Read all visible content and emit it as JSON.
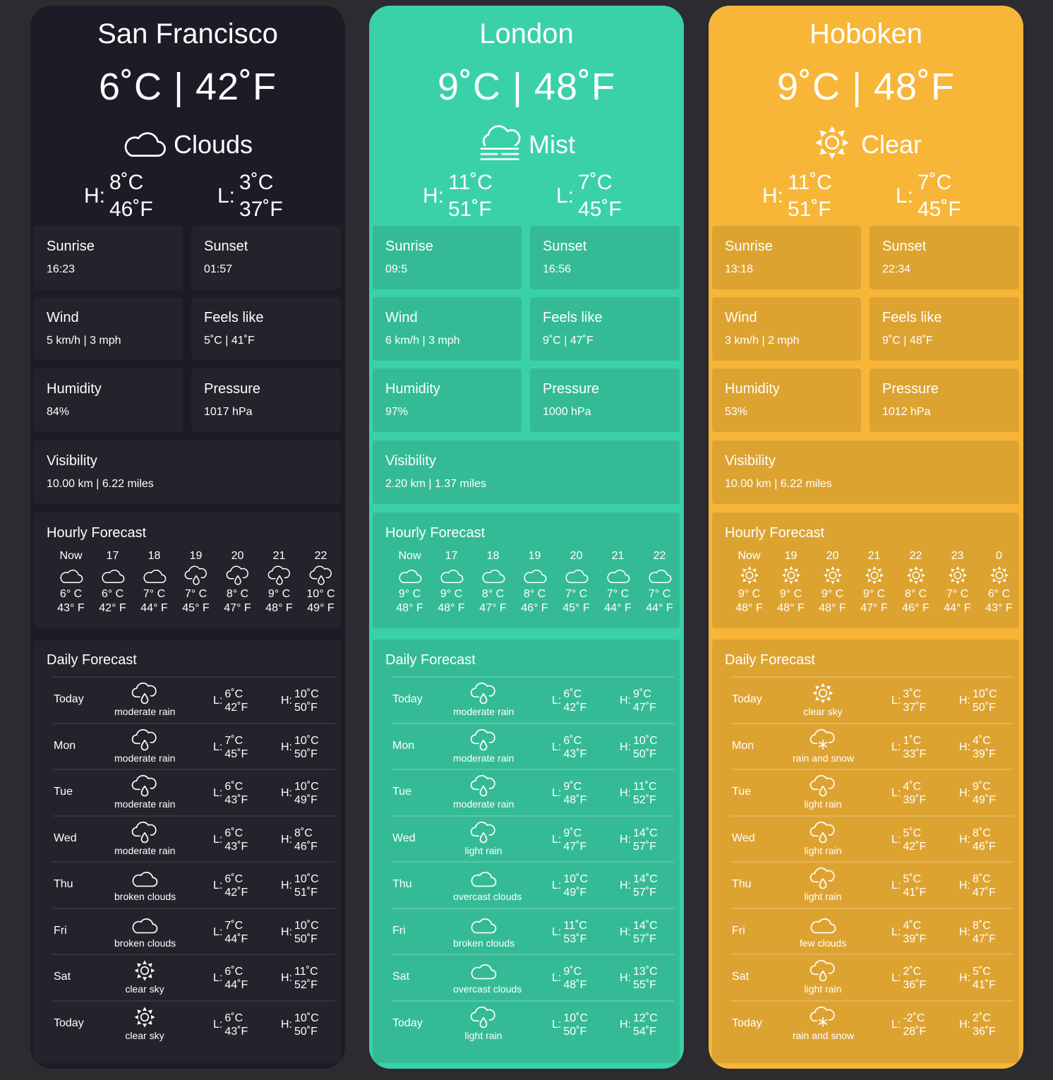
{
  "cities": [
    {
      "name": "San Francisco",
      "temp": "6˚C | 42˚F",
      "condition": "Clouds",
      "condition_icon": "cloud-icon",
      "high_c": "8˚C",
      "high_f": "46˚F",
      "low_c": "3˚C",
      "low_f": "37˚F",
      "hl_labels": {
        "high": "H:",
        "low": "L:"
      },
      "accent": "#1c1c26",
      "sunrise": {
        "label": "Sunrise",
        "value": "16:23"
      },
      "sunset": {
        "label": "Sunset",
        "value": "01:57"
      },
      "wind": {
        "label": "Wind",
        "value": "5 km/h | 3 mph"
      },
      "feels": {
        "label": "Feels like",
        "value": "5˚C | 41˚F"
      },
      "humidity": {
        "label": "Humidity",
        "value": "84%"
      },
      "pressure": {
        "label": "Pressure",
        "value": "1017 hPa"
      },
      "visibility": {
        "label": "Visibility",
        "value": "10.00 km | 6.22 miles"
      },
      "hourly_title": "Hourly Forecast",
      "hourly": [
        {
          "time": "Now",
          "icon": "cloud",
          "c": "6° C",
          "f": "43° F"
        },
        {
          "time": "17",
          "icon": "cloud",
          "c": "6° C",
          "f": "42° F"
        },
        {
          "time": "18",
          "icon": "cloud",
          "c": "7° C",
          "f": "44° F"
        },
        {
          "time": "19",
          "icon": "rain",
          "c": "7° C",
          "f": "45° F"
        },
        {
          "time": "20",
          "icon": "rain",
          "c": "8° C",
          "f": "47° F"
        },
        {
          "time": "21",
          "icon": "rain",
          "c": "9° C",
          "f": "48° F"
        },
        {
          "time": "22",
          "icon": "rain",
          "c": "10° C",
          "f": "49° F"
        }
      ],
      "daily_title": "Daily Forecast",
      "daily": [
        {
          "day": "Today",
          "icon": "rain",
          "desc": "moderate rain",
          "lo_c": "6˚C",
          "lo_f": "42˚F",
          "hi_c": "10˚C",
          "hi_f": "50˚F"
        },
        {
          "day": "Mon",
          "icon": "rain",
          "desc": "moderate rain",
          "lo_c": "7˚C",
          "lo_f": "45˚F",
          "hi_c": "10˚C",
          "hi_f": "50˚F"
        },
        {
          "day": "Tue",
          "icon": "rain",
          "desc": "moderate rain",
          "lo_c": "6˚C",
          "lo_f": "43˚F",
          "hi_c": "10˚C",
          "hi_f": "49˚F"
        },
        {
          "day": "Wed",
          "icon": "rain",
          "desc": "moderate rain",
          "lo_c": "6˚C",
          "lo_f": "43˚F",
          "hi_c": "8˚C",
          "hi_f": "46˚F"
        },
        {
          "day": "Thu",
          "icon": "cloud",
          "desc": "broken clouds",
          "lo_c": "6˚C",
          "lo_f": "42˚F",
          "hi_c": "10˚C",
          "hi_f": "51˚F"
        },
        {
          "day": "Fri",
          "icon": "cloud",
          "desc": "broken clouds",
          "lo_c": "7˚C",
          "lo_f": "44˚F",
          "hi_c": "10˚C",
          "hi_f": "50˚F"
        },
        {
          "day": "Sat",
          "icon": "sun",
          "desc": "clear sky",
          "lo_c": "6˚C",
          "lo_f": "44˚F",
          "hi_c": "11˚C",
          "hi_f": "52˚F"
        },
        {
          "day": "Today",
          "icon": "sun",
          "desc": "clear sky",
          "lo_c": "6˚C",
          "lo_f": "43˚F",
          "hi_c": "10˚C",
          "hi_f": "50˚F"
        }
      ]
    },
    {
      "name": "London",
      "temp": "9˚C | 48˚F",
      "condition": "Mist",
      "condition_icon": "mist-icon",
      "high_c": "11˚C",
      "high_f": "51˚F",
      "low_c": "7˚C",
      "low_f": "45˚F",
      "hl_labels": {
        "high": "H:",
        "low": "L:"
      },
      "accent": "#3ad1a8",
      "sunrise": {
        "label": "Sunrise",
        "value": "09:5"
      },
      "sunset": {
        "label": "Sunset",
        "value": "16:56"
      },
      "wind": {
        "label": "Wind",
        "value": "6 km/h | 3 mph"
      },
      "feels": {
        "label": "Feels like",
        "value": "9˚C | 47˚F"
      },
      "humidity": {
        "label": "Humidity",
        "value": "97%"
      },
      "pressure": {
        "label": "Pressure",
        "value": "1000 hPa"
      },
      "visibility": {
        "label": "Visibility",
        "value": "2.20 km | 1.37 miles"
      },
      "hourly_title": "Hourly Forecast",
      "hourly": [
        {
          "time": "Now",
          "icon": "cloud",
          "c": "9° C",
          "f": "48° F"
        },
        {
          "time": "17",
          "icon": "cloud",
          "c": "9° C",
          "f": "48° F"
        },
        {
          "time": "18",
          "icon": "cloud",
          "c": "8° C",
          "f": "47° F"
        },
        {
          "time": "19",
          "icon": "cloud",
          "c": "8° C",
          "f": "46° F"
        },
        {
          "time": "20",
          "icon": "cloud",
          "c": "7° C",
          "f": "45° F"
        },
        {
          "time": "21",
          "icon": "cloud",
          "c": "7° C",
          "f": "44° F"
        },
        {
          "time": "22",
          "icon": "cloud",
          "c": "7° C",
          "f": "44° F"
        }
      ],
      "daily_title": "Daily Forecast",
      "daily": [
        {
          "day": "Today",
          "icon": "rain",
          "desc": "moderate rain",
          "lo_c": "6˚C",
          "lo_f": "42˚F",
          "hi_c": "9˚C",
          "hi_f": "47˚F"
        },
        {
          "day": "Mon",
          "icon": "rain",
          "desc": "moderate rain",
          "lo_c": "6˚C",
          "lo_f": "43˚F",
          "hi_c": "10˚C",
          "hi_f": "50˚F"
        },
        {
          "day": "Tue",
          "icon": "rain",
          "desc": "moderate rain",
          "lo_c": "9˚C",
          "lo_f": "48˚F",
          "hi_c": "11˚C",
          "hi_f": "52˚F"
        },
        {
          "day": "Wed",
          "icon": "rain",
          "desc": "light rain",
          "lo_c": "9˚C",
          "lo_f": "47˚F",
          "hi_c": "14˚C",
          "hi_f": "57˚F"
        },
        {
          "day": "Thu",
          "icon": "cloud",
          "desc": "overcast clouds",
          "lo_c": "10˚C",
          "lo_f": "49˚F",
          "hi_c": "14˚C",
          "hi_f": "57˚F"
        },
        {
          "day": "Fri",
          "icon": "cloud",
          "desc": "broken clouds",
          "lo_c": "11˚C",
          "lo_f": "53˚F",
          "hi_c": "14˚C",
          "hi_f": "57˚F"
        },
        {
          "day": "Sat",
          "icon": "cloud",
          "desc": "overcast clouds",
          "lo_c": "9˚C",
          "lo_f": "48˚F",
          "hi_c": "13˚C",
          "hi_f": "55˚F"
        },
        {
          "day": "Today",
          "icon": "rain",
          "desc": "light rain",
          "lo_c": "10˚C",
          "lo_f": "50˚F",
          "hi_c": "12˚C",
          "hi_f": "54˚F"
        }
      ]
    },
    {
      "name": "Hoboken",
      "temp": "9˚C | 48˚F",
      "condition": "Clear",
      "condition_icon": "sun-icon",
      "high_c": "11˚C",
      "high_f": "51˚F",
      "low_c": "7˚C",
      "low_f": "45˚F",
      "hl_labels": {
        "high": "H:",
        "low": "L:"
      },
      "accent": "#f7b637",
      "sunrise": {
        "label": "Sunrise",
        "value": "13:18"
      },
      "sunset": {
        "label": "Sunset",
        "value": "22:34"
      },
      "wind": {
        "label": "Wind",
        "value": "3 km/h | 2 mph"
      },
      "feels": {
        "label": "Feels like",
        "value": "9˚C | 48˚F"
      },
      "humidity": {
        "label": "Humidity",
        "value": "53%"
      },
      "pressure": {
        "label": "Pressure",
        "value": "1012 hPa"
      },
      "visibility": {
        "label": "Visibility",
        "value": "10.00 km | 6.22 miles"
      },
      "hourly_title": "Hourly Forecast",
      "hourly": [
        {
          "time": "Now",
          "icon": "sun",
          "c": "9° C",
          "f": "48° F"
        },
        {
          "time": "19",
          "icon": "sun",
          "c": "9° C",
          "f": "48° F"
        },
        {
          "time": "20",
          "icon": "sun",
          "c": "9° C",
          "f": "48° F"
        },
        {
          "time": "21",
          "icon": "sun",
          "c": "9° C",
          "f": "47° F"
        },
        {
          "time": "22",
          "icon": "sun",
          "c": "8° C",
          "f": "46° F"
        },
        {
          "time": "23",
          "icon": "sun",
          "c": "7° C",
          "f": "44° F"
        },
        {
          "time": "0",
          "icon": "sun",
          "c": "6° C",
          "f": "43° F"
        }
      ],
      "daily_title": "Daily Forecast",
      "daily": [
        {
          "day": "Today",
          "icon": "sun",
          "desc": "clear sky",
          "lo_c": "3˚C",
          "lo_f": "37˚F",
          "hi_c": "10˚C",
          "hi_f": "50˚F"
        },
        {
          "day": "Mon",
          "icon": "snow",
          "desc": "rain and snow",
          "lo_c": "1˚C",
          "lo_f": "33˚F",
          "hi_c": "4˚C",
          "hi_f": "39˚F"
        },
        {
          "day": "Tue",
          "icon": "rain",
          "desc": "light rain",
          "lo_c": "4˚C",
          "lo_f": "39˚F",
          "hi_c": "9˚C",
          "hi_f": "49˚F"
        },
        {
          "day": "Wed",
          "icon": "rain",
          "desc": "light rain",
          "lo_c": "5˚C",
          "lo_f": "42˚F",
          "hi_c": "8˚C",
          "hi_f": "46˚F"
        },
        {
          "day": "Thu",
          "icon": "rain",
          "desc": "light rain",
          "lo_c": "5˚C",
          "lo_f": "41˚F",
          "hi_c": "8˚C",
          "hi_f": "47˚F"
        },
        {
          "day": "Fri",
          "icon": "cloud",
          "desc": "few clouds",
          "lo_c": "4˚C",
          "lo_f": "39˚F",
          "hi_c": "8˚C",
          "hi_f": "47˚F"
        },
        {
          "day": "Sat",
          "icon": "rain",
          "desc": "light rain",
          "lo_c": "2˚C",
          "lo_f": "36˚F",
          "hi_c": "5˚C",
          "hi_f": "41˚F"
        },
        {
          "day": "Today",
          "icon": "snow",
          "desc": "rain and snow",
          "lo_c": "-2˚C",
          "lo_f": "28˚F",
          "hi_c": "2˚C",
          "hi_f": "36˚F"
        }
      ]
    }
  ]
}
